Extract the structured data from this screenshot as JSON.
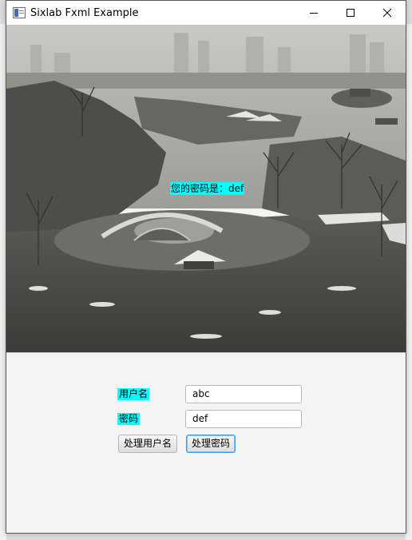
{
  "window": {
    "title": "Sixlab Fxml Example",
    "icon": "java-app-icon",
    "controls": [
      "minimize-icon",
      "maximize-icon",
      "close-icon"
    ]
  },
  "scene": {
    "image": "snowy-lake-park-photo",
    "hint_text": "您的密码是：def"
  },
  "form": {
    "username_label": "用户名",
    "username_value": "abc",
    "password_label": "密码",
    "password_value": "def",
    "process_username_button": "处理用户名",
    "process_password_button": "处理密码"
  },
  "colors": {
    "label_highlight": "#00ffff",
    "focus_border": "#3b9ad9"
  }
}
